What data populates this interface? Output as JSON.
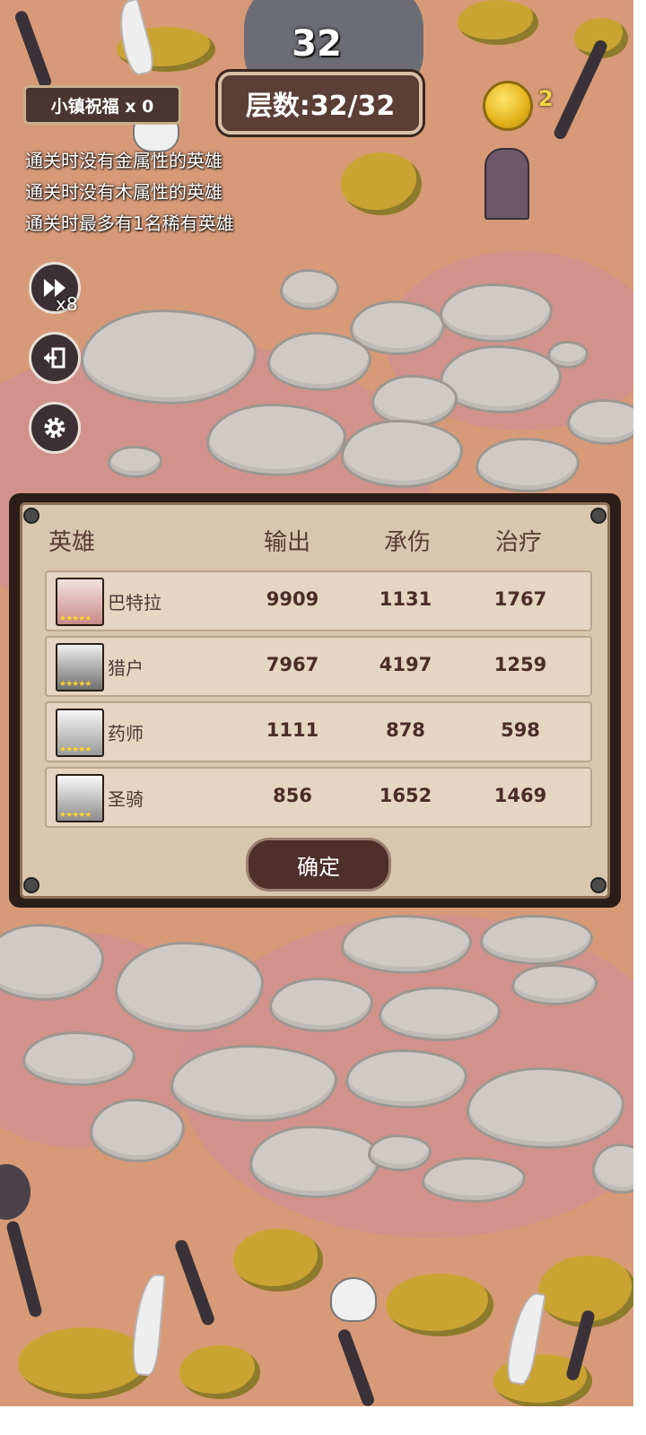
{
  "hud": {
    "floor_number": "32",
    "floor_label": "层数:32/32",
    "blessing": "小镇祝福 x 0",
    "coins": "2",
    "speed": "x8"
  },
  "conditions": [
    "通关时没有金属性的英雄",
    "通关时没有木属性的英雄",
    "通关时最多有1名稀有英雄"
  ],
  "panel": {
    "headers": {
      "hero": "英雄",
      "output": "输出",
      "damage_taken": "承伤",
      "healing": "治疗"
    },
    "rows": [
      {
        "name": "巴特拉",
        "output": "9909",
        "damage_taken": "1131",
        "healing": "1767"
      },
      {
        "name": "猎户",
        "output": "7967",
        "damage_taken": "4197",
        "healing": "1259"
      },
      {
        "name": "药师",
        "output": "1111",
        "damage_taken": "878",
        "healing": "598"
      },
      {
        "name": "圣骑",
        "output": "856",
        "damage_taken": "1652",
        "healing": "1469"
      }
    ],
    "confirm": "确定"
  },
  "colors": {
    "panel_bg": "#d8c7ae",
    "frame": "#2b1d18",
    "coin": "#e3b21a",
    "ground": "#d79a78"
  },
  "icons": [
    "fast-forward-icon",
    "exit-icon",
    "gear-icon",
    "coin-icon",
    "skull-icon"
  ]
}
